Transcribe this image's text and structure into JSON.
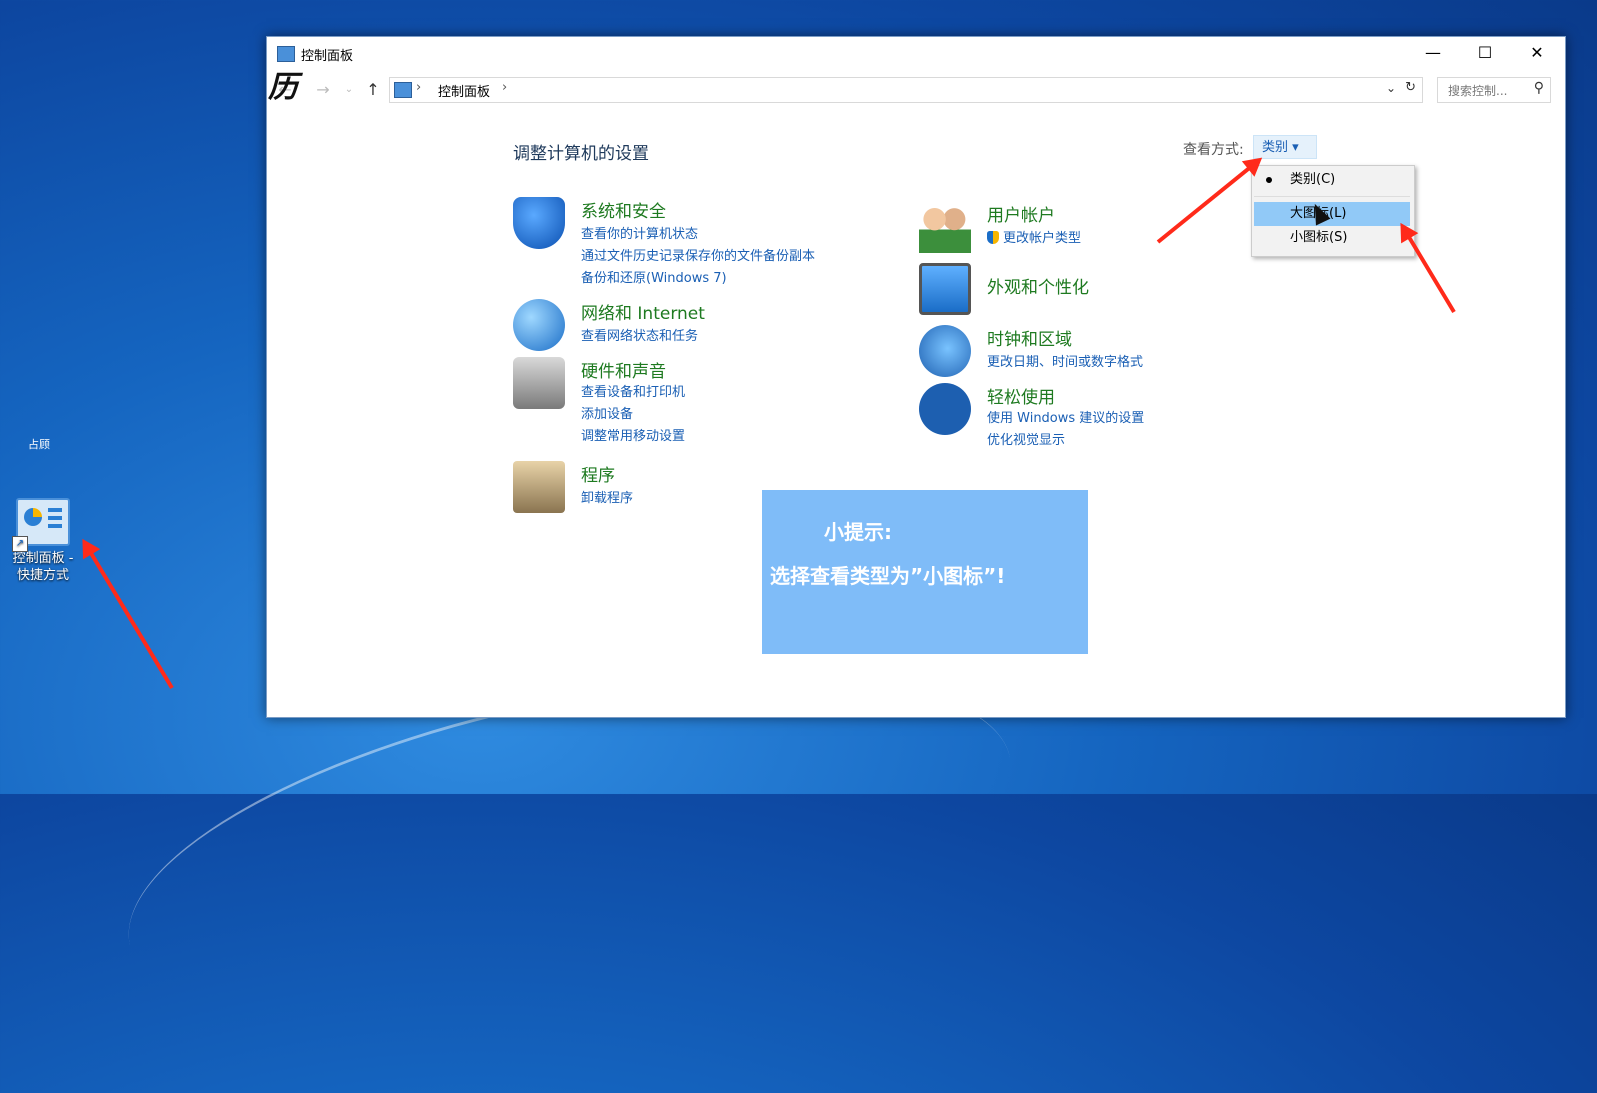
{
  "desktop": {
    "partial_label": "占顾",
    "shortcut_label_line1": "控制面板 -",
    "shortcut_label_line2": "快捷方式"
  },
  "window": {
    "title": "控制面板",
    "minimize": "—",
    "maximize": "☐",
    "close": "✕"
  },
  "nav": {
    "back": "←",
    "forward": "→",
    "dropdown": "⌄",
    "up": "↑",
    "sep1": "›",
    "crumb": "控制面板",
    "sep2": "›",
    "addr_drop": "⌄",
    "refresh": "↻",
    "search_placeholder": "搜索控制...",
    "search_icon": "⚲"
  },
  "main": {
    "heading": "调整计算机的设置",
    "view_by_label": "查看方式:",
    "view_by_value": "类别 ▾"
  },
  "view_menu": {
    "items": [
      "类别(C)",
      "大图标(L)",
      "小图标(S)"
    ],
    "selected": "类别(C)",
    "highlighted": "大图标(L)"
  },
  "categories_left": [
    {
      "name": "系统和安全",
      "links": [
        "查看你的计算机状态",
        "通过文件历史记录保存你的文件备份副本",
        "备份和还原(Windows 7)"
      ]
    },
    {
      "name": "网络和 Internet",
      "links": [
        "查看网络状态和任务"
      ]
    },
    {
      "name": "硬件和声音",
      "links": [
        "查看设备和打印机",
        "添加设备",
        "调整常用移动设置"
      ]
    },
    {
      "name": "程序",
      "links": [
        "卸载程序"
      ]
    }
  ],
  "categories_right": [
    {
      "name": "用户帐户",
      "links": [
        "更改帐户类型"
      ]
    },
    {
      "name": "外观和个性化",
      "links": []
    },
    {
      "name": "时钟和区域",
      "links": [
        "更改日期、时间或数字格式"
      ]
    },
    {
      "name": "轻松使用",
      "links": [
        "使用 Windows 建议的设置",
        "优化视觉显示"
      ]
    }
  ],
  "tip": {
    "line1": "小提示:",
    "line2": "选择查看类型为”小图标”!"
  },
  "overlay": {
    "brand_glyph": "历"
  },
  "colors": {
    "category_green": "#1e7a20",
    "link_blue": "#1a5fb4",
    "tip_bg": "#7fbcf8",
    "arrow_red": "#ff2a1a",
    "menu_highlight": "#91c9f7"
  }
}
